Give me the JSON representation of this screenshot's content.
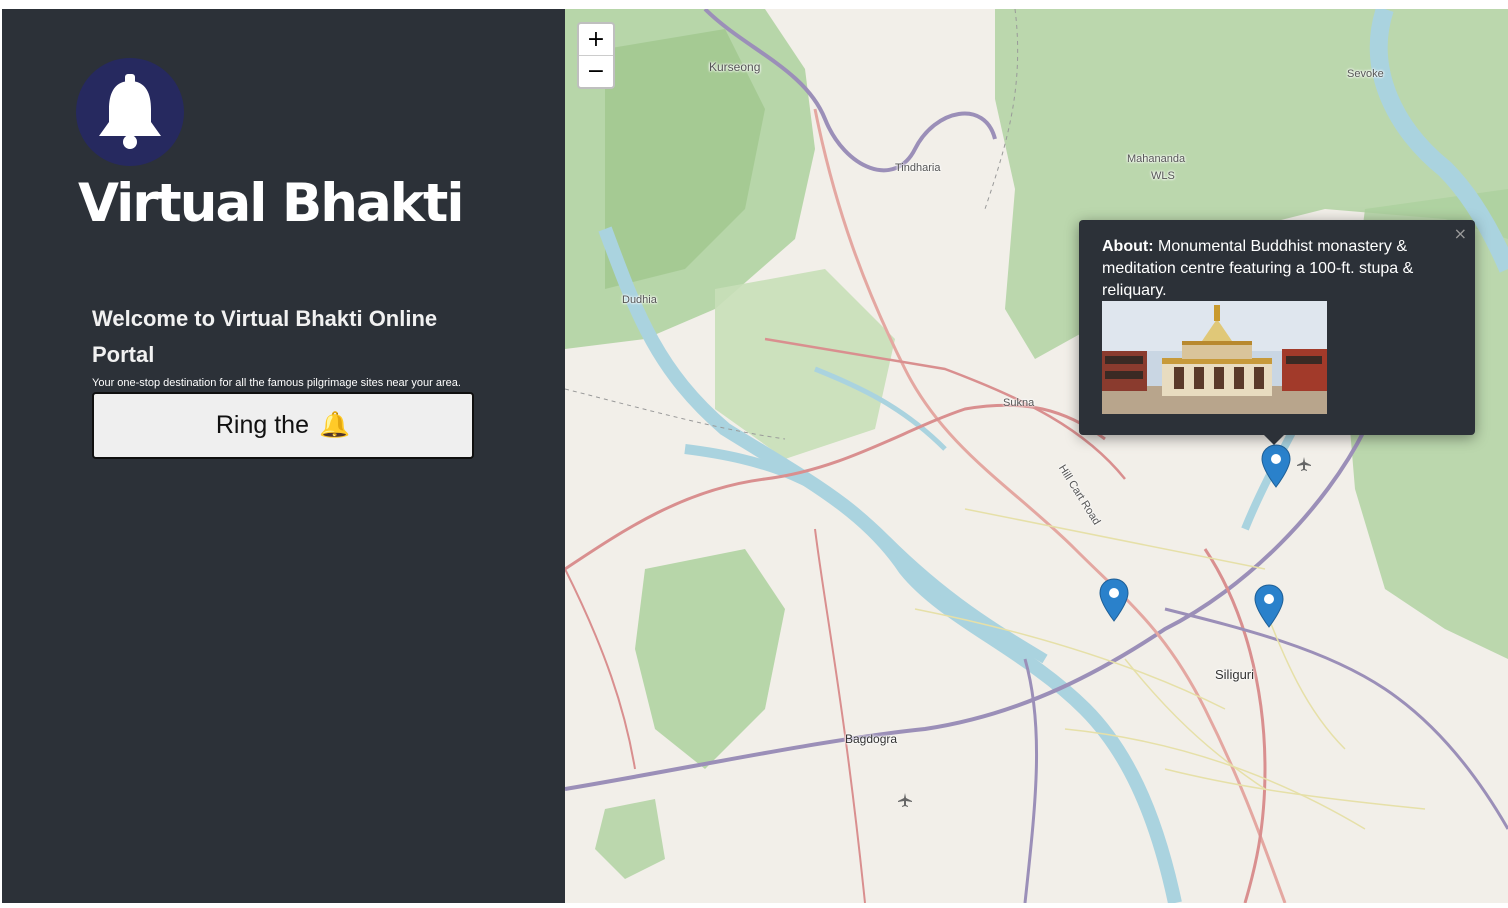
{
  "brand": {
    "name": "Virtual Bhakti",
    "logo_icon": "bell-icon",
    "logo_color": "#26295f"
  },
  "intro": {
    "welcome": "Welcome to Virtual Bhakti Online Portal",
    "tagline": "Your one-stop destination for all the famous pilgrimage sites near your area."
  },
  "ring_button": {
    "label": "Ring the",
    "icon": "bell-icon",
    "icon_glyph": "🔔"
  },
  "map": {
    "zoom_in": "+",
    "zoom_out": "−",
    "place_labels": {
      "kurseong": "Kurseong",
      "sevoke": "Sevoke",
      "mahananda": "Mahananda",
      "wls": "WLS",
      "tindharia": "Tindharia",
      "dudhia": "Dudhia",
      "sukna": "Sukna",
      "hill_cart_road": "Hill Cart Road",
      "siliguri": "Siliguri",
      "bagdogra": "Bagdogra"
    },
    "markers": [
      "marker-monastery",
      "marker-west",
      "marker-east"
    ],
    "popup": {
      "close": "×",
      "about_label": "About:",
      "about_text": "Monumental Buddhist monastery & meditation centre featuring a 100-ft. stupa & reliquary."
    }
  },
  "colors": {
    "sidebar_bg": "#2c3138",
    "marker_blue": "#2a81cb",
    "river": "#aad3df",
    "forest": "#add19e"
  }
}
